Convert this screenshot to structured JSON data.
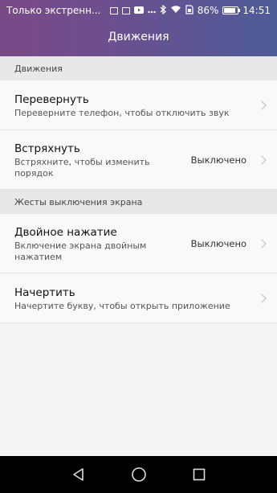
{
  "status_bar": {
    "carrier": "Только экстренн...",
    "battery_percent": "86%",
    "battery_level": 0.86,
    "time": "14:51",
    "icons": [
      "keyboard-icon",
      "image-icon",
      "youtube-icon",
      "more-icon",
      "bluetooth-icon",
      "wifi-icon",
      "sim-icon"
    ]
  },
  "header": {
    "title": "Движения"
  },
  "sections": [
    {
      "header": "Движения",
      "items": [
        {
          "title": "Перевернуть",
          "subtitle": "Переверните телефон, чтобы отключить звук",
          "value": ""
        },
        {
          "title": "Встряхнуть",
          "subtitle": "Встряхните, чтобы изменить порядок",
          "value": "Выключено"
        }
      ]
    },
    {
      "header": "Жесты выключения экрана",
      "items": [
        {
          "title": "Двойное нажатие",
          "subtitle": "Включение экрана двойным нажатием",
          "value": "Выключено"
        },
        {
          "title": "Начертить",
          "subtitle": "Начертите букву, чтобы открыть приложение",
          "value": ""
        }
      ]
    }
  ],
  "nav": {
    "icons": [
      "back-icon",
      "home-icon",
      "recents-icon"
    ]
  }
}
